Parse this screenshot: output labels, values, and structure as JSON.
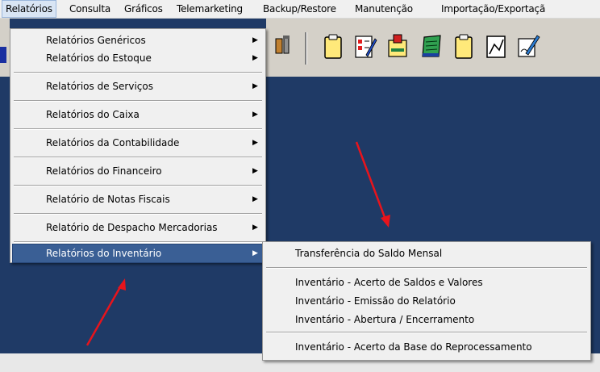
{
  "menubar": {
    "items": [
      {
        "label": "Relatórios",
        "active": true
      },
      {
        "label": "Consulta"
      },
      {
        "label": "Gráficos"
      },
      {
        "label": "Telemarketing"
      },
      {
        "label": "Backup/Restore"
      },
      {
        "label": "Manutenção"
      },
      {
        "label": "Importação/Exportaçã"
      }
    ]
  },
  "relatorios_menu": {
    "items": [
      {
        "label": "Relatórios Genéricos"
      },
      {
        "label": "Relatórios do Estoque"
      },
      {
        "label": "Relatórios de Serviços"
      },
      {
        "label": "Relatórios do Caixa"
      },
      {
        "label": "Relatórios da Contabilidade"
      },
      {
        "label": "Relatórios do Financeiro"
      },
      {
        "label": "Relatório de Notas Fiscais"
      },
      {
        "label": "Relatório de Despacho Mercadorias"
      },
      {
        "label": "Relatórios do Inventário"
      }
    ],
    "submenu_arrow": "▶"
  },
  "inventario_submenu": {
    "items": [
      {
        "label": "Transferência do Saldo Mensal"
      },
      {
        "label": "Inventário - Acerto de Saldos e Valores"
      },
      {
        "label": "Inventário - Emissão do Relatório"
      },
      {
        "label": "Inventário - Abertura / Encerramento"
      },
      {
        "label": "Inventário - Acerto da Base do Reprocessamento"
      }
    ]
  },
  "toolbar": {
    "icons": [
      "tools-icon",
      "clipboard-icon",
      "checklist-edit-icon",
      "document-stamp-icon",
      "notepad-icon",
      "clipboard-blank-icon",
      "chart-window-icon",
      "pen-sign-icon"
    ]
  },
  "colors": {
    "desktop": "#1f3a66",
    "menu_bg": "#f0f0f0",
    "selection": "#3a5f95",
    "annotation_arrow": "#e8141c"
  }
}
